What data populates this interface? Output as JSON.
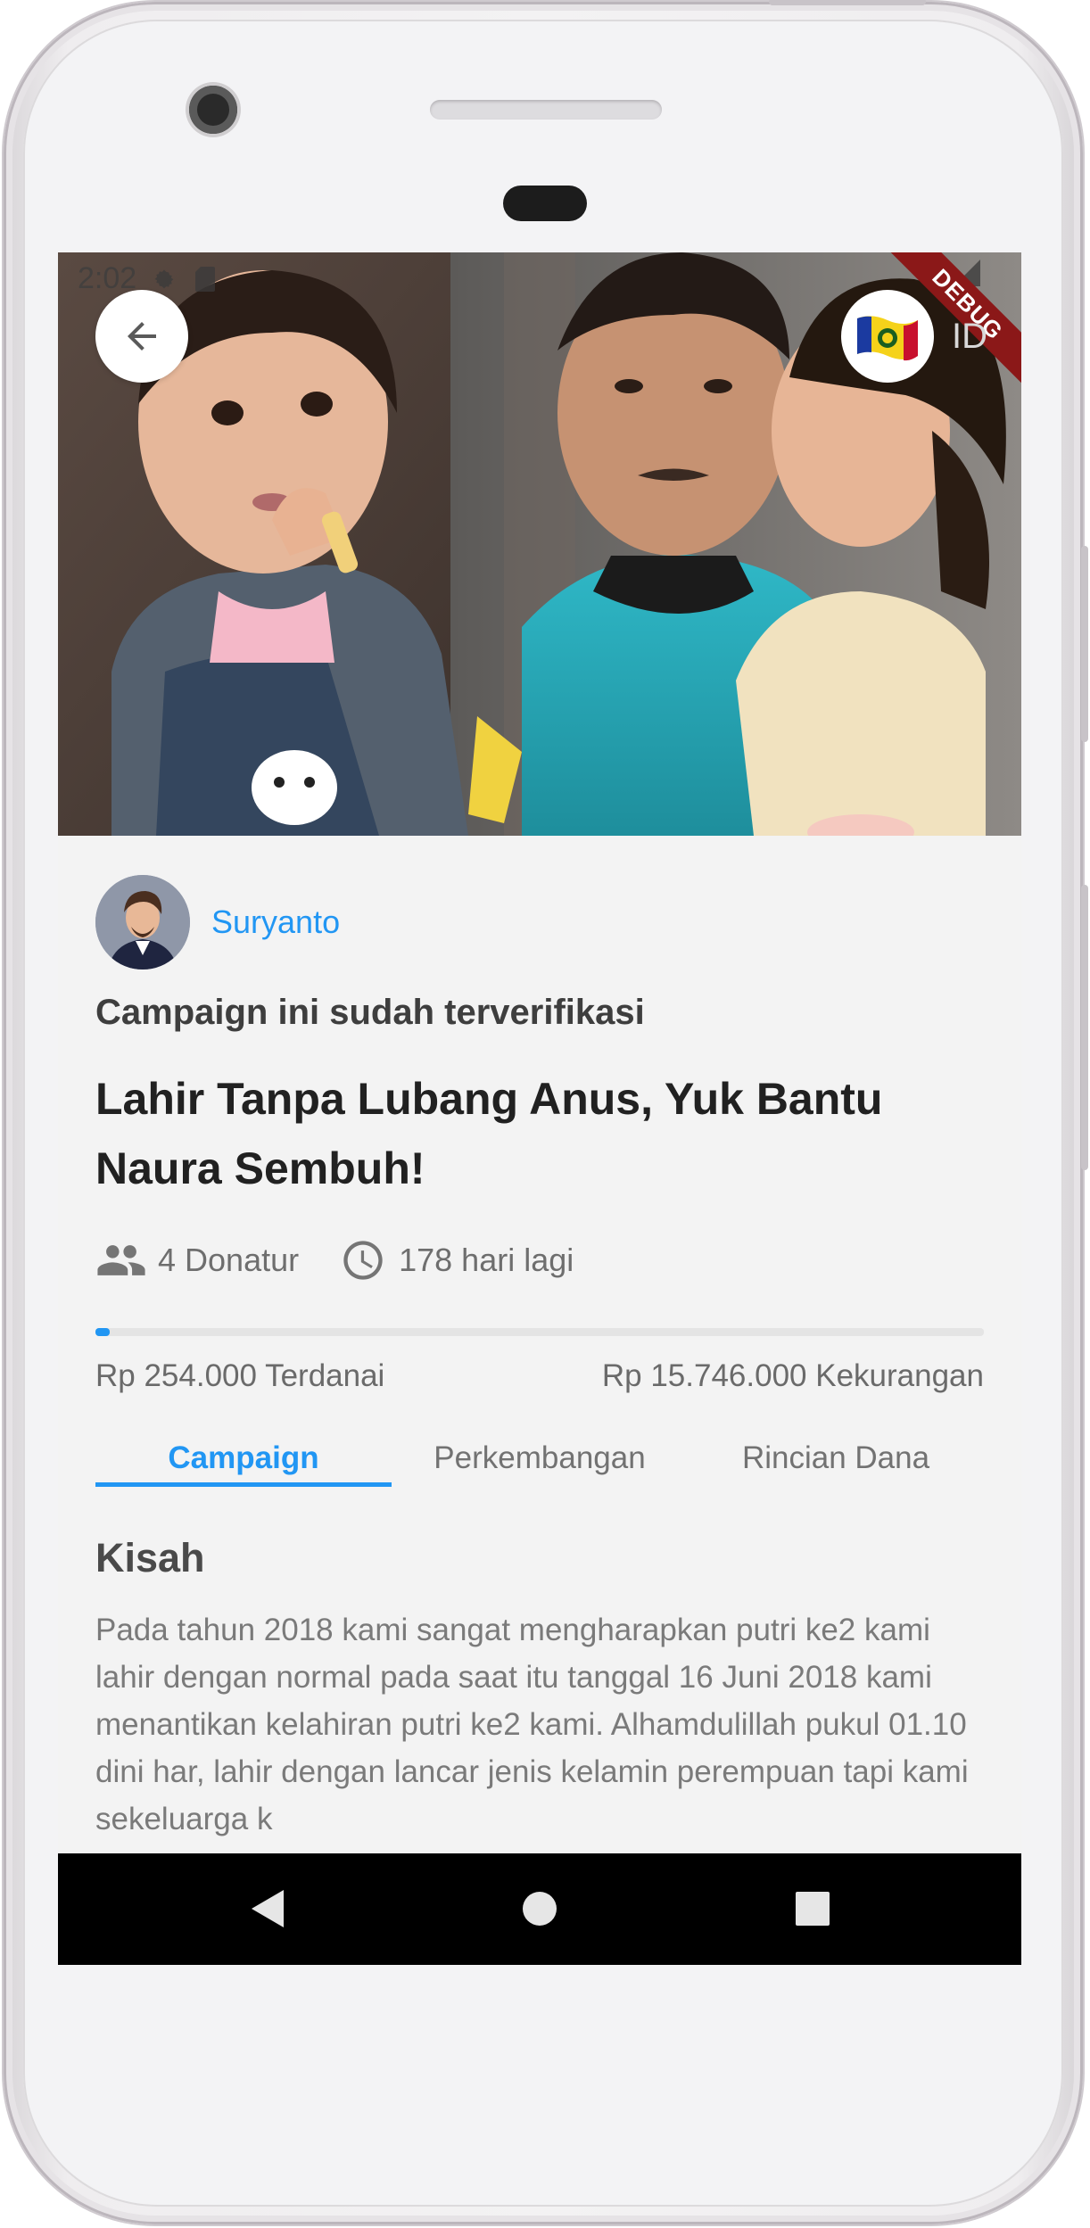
{
  "status_bar": {
    "time": "2:02"
  },
  "debug_banner": "DEBUG",
  "header": {
    "language_code": "ID"
  },
  "campaign": {
    "author_name": "Suryanto",
    "verified_text": "Campaign ini sudah terverifikasi",
    "title": "Lahir Tanpa Lubang Anus, Yuk Bantu Naura Sembuh!",
    "donors_text": "4 Donatur",
    "days_left_text": "178 hari lagi",
    "progress": 0.016,
    "raised_text": "Rp 254.000 Terdanai",
    "remaining_text": "Rp 15.746.000 Kekurangan"
  },
  "tabs": [
    {
      "label": "Campaign",
      "active": true
    },
    {
      "label": "Perkembangan",
      "active": false
    },
    {
      "label": "Rincian Dana",
      "active": false
    }
  ],
  "story": {
    "heading": "Kisah",
    "text": "Pada tahun 2018 kami sangat mengharapkan putri ke2 kami lahir dengan normal pada saat itu tanggal 16 Juni 2018 kami menantikan kelahiran putri ke2 kami. Alhamdulillah pukul 01.10 dini har, lahir dengan lancar jenis kelamin perempuan tapi kami sekeluarga k"
  },
  "colors": {
    "accent": "#2196f3",
    "debug": "#8b1818"
  },
  "icons": [
    "back-arrow-icon",
    "flag-icon",
    "people-icon",
    "clock-icon",
    "nav-back-icon",
    "nav-home-icon",
    "nav-recents-icon"
  ]
}
